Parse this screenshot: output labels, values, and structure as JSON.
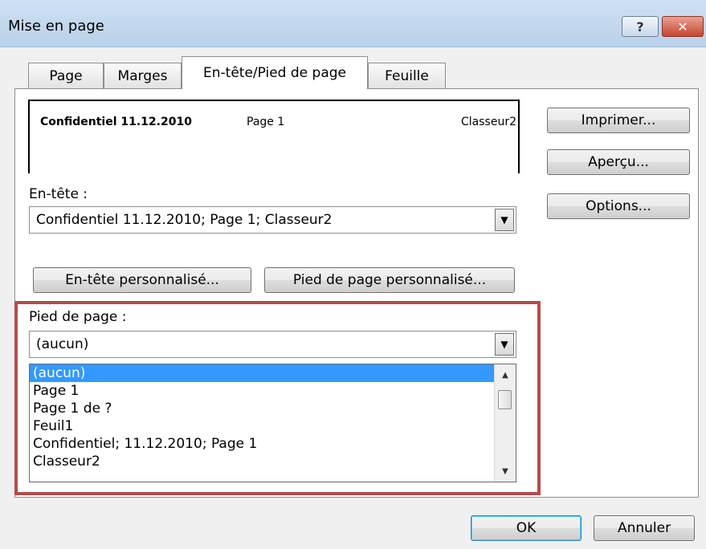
{
  "window": {
    "title": "Mise en page"
  },
  "titlebar": {
    "help_label": "?",
    "close_label": "✕"
  },
  "tabs": [
    {
      "label": "Page",
      "active": false
    },
    {
      "label": "Marges",
      "active": false
    },
    {
      "label": "En-tête/Pied de page",
      "active": true
    },
    {
      "label": "Feuille",
      "active": false
    }
  ],
  "preview": {
    "left": "Confidentiel 11.12.2010",
    "center": "Page 1",
    "right": "Classeur2"
  },
  "header": {
    "label": "En-tête :",
    "value": "Confidentiel 11.12.2010; Page 1; Classeur2"
  },
  "custom_buttons": {
    "header": "En-tête personnalisé...",
    "footer": "Pied de page personnalisé..."
  },
  "footer": {
    "label": "Pied de page :",
    "value": "(aucun)",
    "options": [
      {
        "label": "(aucun)",
        "selected": true
      },
      {
        "label": "Page 1"
      },
      {
        "label": "Page 1 de ?"
      },
      {
        "label": "Feuil1"
      },
      {
        "label": " Confidentiel; 11.12.2010; Page 1"
      },
      {
        "label": "Classeur2"
      }
    ]
  },
  "side_buttons": {
    "print": "Imprimer...",
    "preview": "Aperçu...",
    "options": "Options..."
  },
  "footer_buttons": {
    "ok": "OK",
    "cancel": "Annuler"
  },
  "icons": {
    "dropdown": "chevron-down-icon",
    "scroll_up": "scroll-up-icon",
    "scroll_down": "scroll-down-icon"
  }
}
